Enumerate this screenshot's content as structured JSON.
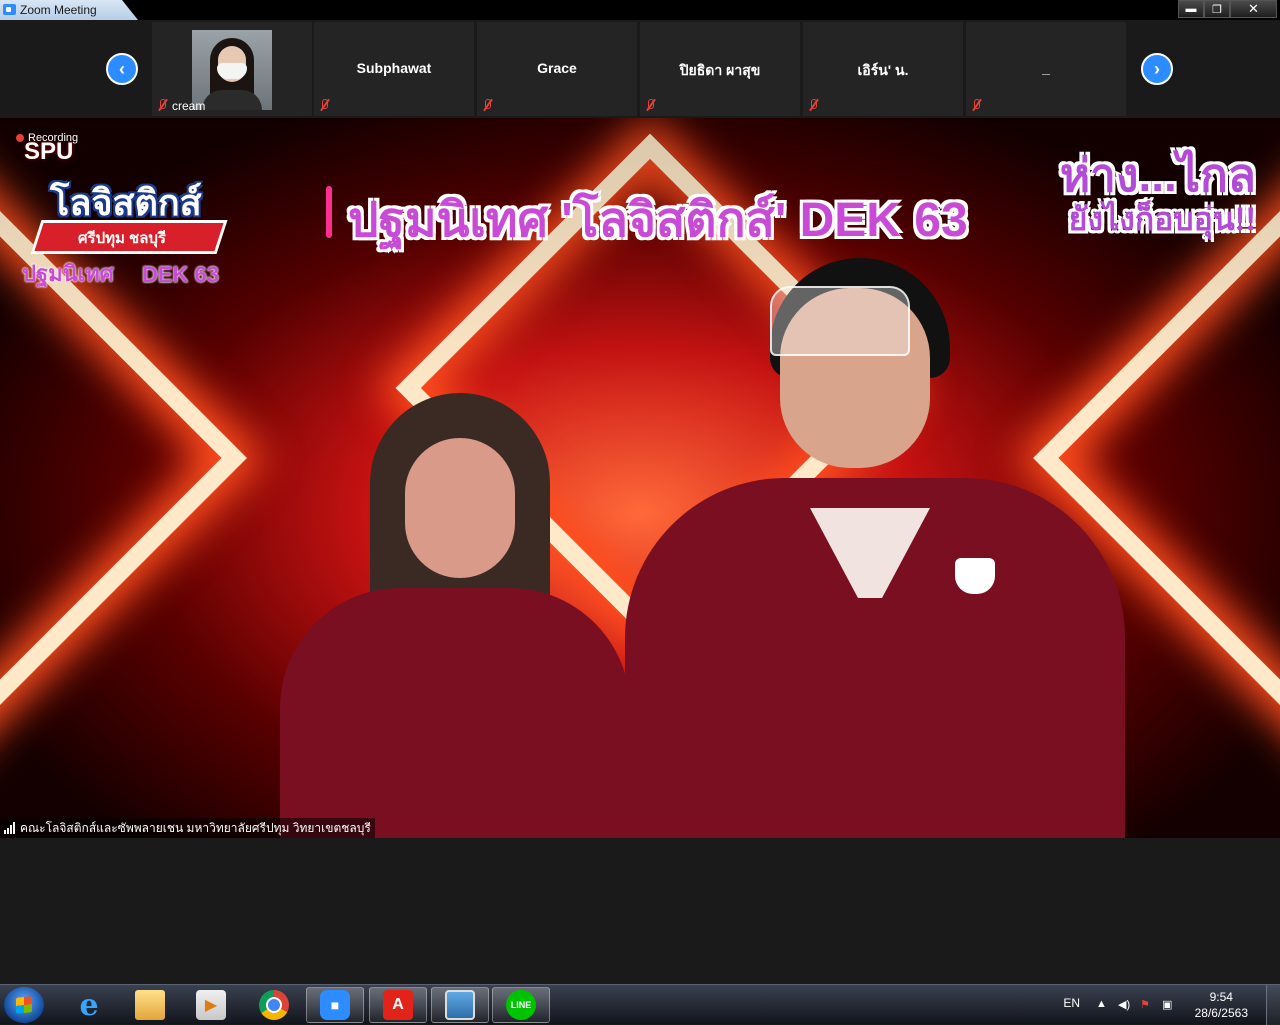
{
  "window": {
    "title": "Zoom Meeting",
    "min_label": "▬",
    "max_label": "❐",
    "close_label": "✕"
  },
  "gallery": {
    "prev_label": "‹",
    "next_label": "›",
    "participants": [
      {
        "name": "cream",
        "has_video": true
      },
      {
        "name": "Subphawat"
      },
      {
        "name": "Grace"
      },
      {
        "name": "ปิยธิดา ผาสุข"
      },
      {
        "name": "เอิร์น' น."
      },
      {
        "name": "_"
      }
    ]
  },
  "video": {
    "recording_label": "Recording",
    "logo": {
      "top": "SPU",
      "main": "โลจิสติกส์",
      "sub": "ศรีปทุม ชลบุรี",
      "tag": "ปฐมนิเทศ",
      "dek": "DEK 63"
    },
    "headline": "ปฐมนิเทศ 'โลจิสติกส์' DEK 63",
    "side_line1": "ห่าง...ไกล",
    "side_line2": "ยังไงก็อบอุ่น!!",
    "host_caption": "คณะโลจิสติกส์และซัพพลายเชน มหาวิทยาลัยศรีปทุม วิทยาเขตชลบุรี"
  },
  "taskbar": {
    "apps": [
      {
        "name": "internet-explorer",
        "glyph": "e"
      },
      {
        "name": "file-explorer",
        "glyph": ""
      },
      {
        "name": "media-player",
        "glyph": "▶"
      },
      {
        "name": "chrome",
        "glyph": ""
      },
      {
        "name": "zoom",
        "glyph": "■"
      },
      {
        "name": "acrobat",
        "glyph": "A"
      },
      {
        "name": "photo-viewer",
        "glyph": ""
      },
      {
        "name": "line",
        "glyph": "LINE"
      }
    ],
    "language": "EN",
    "time": "9:54",
    "date": "28/6/2563"
  },
  "colors": {
    "zoom_blue": "#2d8cff",
    "muted_red": "#e5413a",
    "shirt": "#7a0f22"
  }
}
